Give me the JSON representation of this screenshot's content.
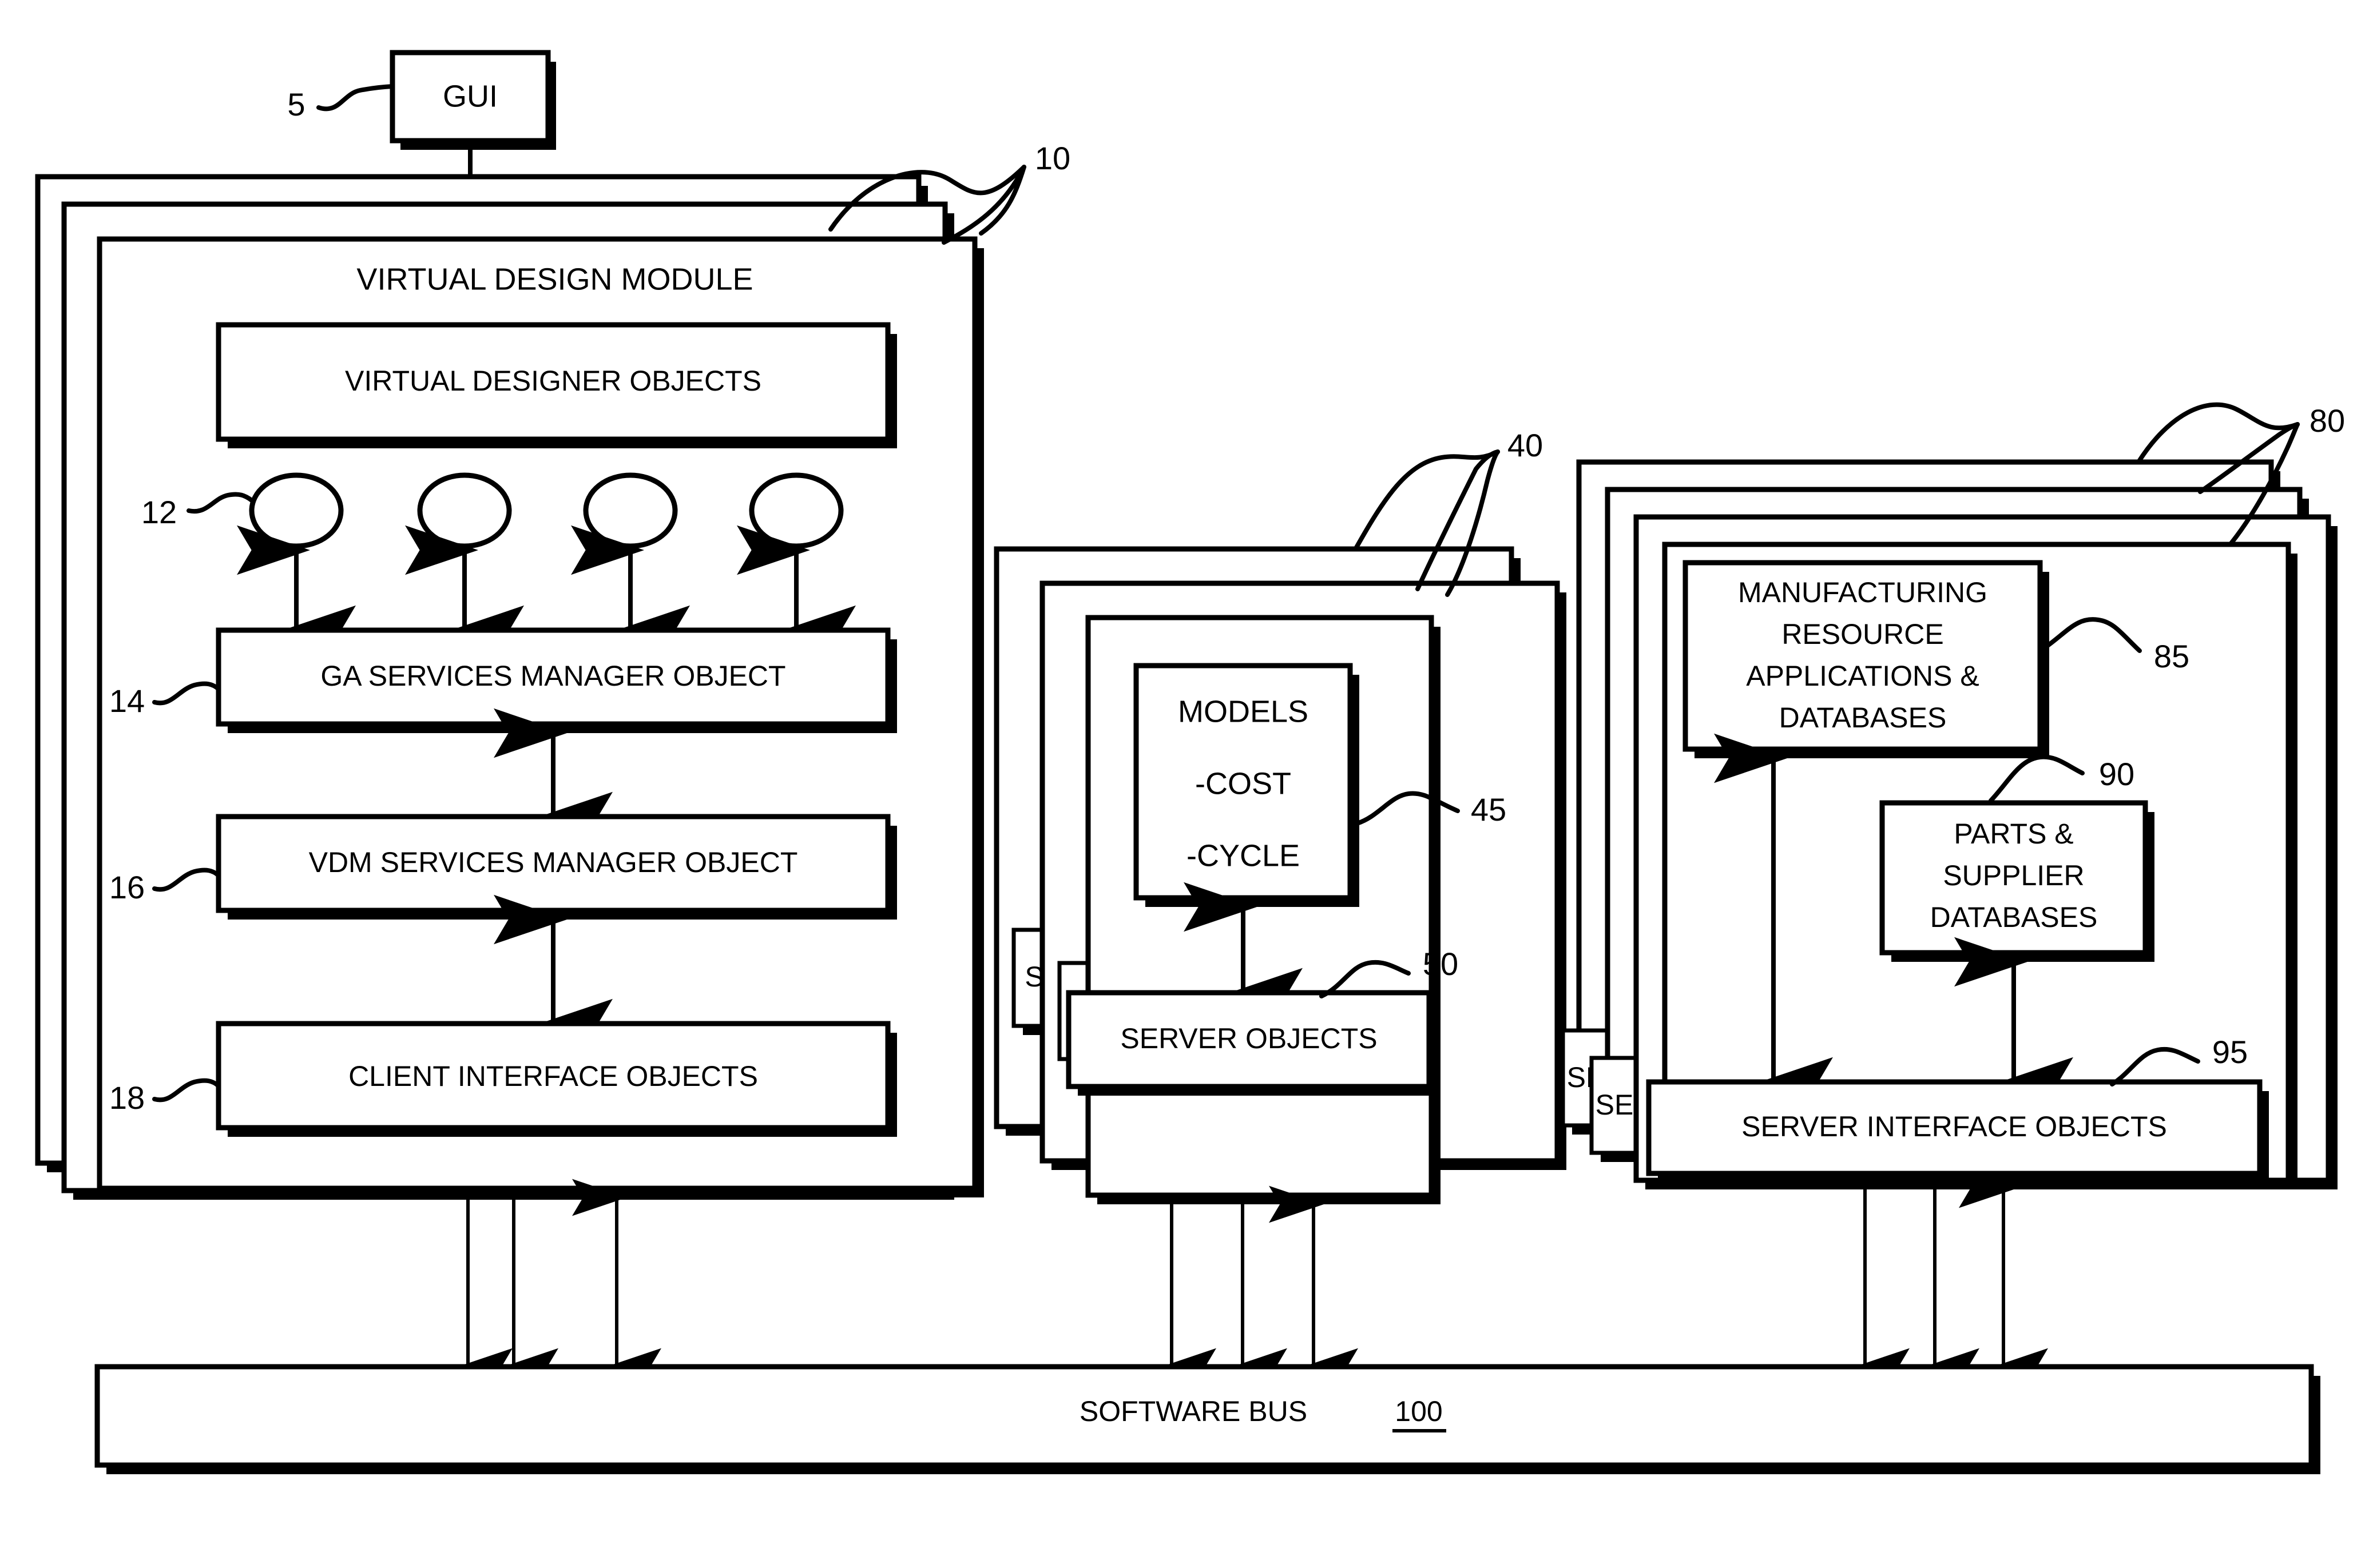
{
  "figure": {
    "title": "Virtual Design Module system architecture block diagram",
    "background_color": "#ffffff",
    "line_color": "#000000"
  },
  "blocks": {
    "gui": "GUI",
    "virtual_design_module": "VIRTUAL DESIGN MODULE",
    "virtual_designer_objects": "VIRTUAL DESIGNER OBJECTS",
    "ga_services_manager_object": "GA SERVICES MANAGER OBJECT",
    "vdm_services_manager_object": "VDM SERVICES MANAGER OBJECT",
    "client_interface_objects": "CLIENT INTERFACE OBJECTS",
    "models_title": "MODELS",
    "models_item_cost": "-COST",
    "models_item_cycle": "-CYCLE",
    "server_objects": "SERVER OBJECTS",
    "server_objects_abbrev": "S",
    "manufacturing_line1": "MANUFACTURING",
    "manufacturing_line2": "RESOURCE",
    "manufacturing_line3": "APPLICATIONS &",
    "manufacturing_line4": "DATABASES",
    "parts_line1": "PARTS &",
    "parts_line2": "SUPPLIER",
    "parts_line3": "DATABASES",
    "server_interface_objects": "SERVER INTERFACE OBJECTS",
    "server_interface_objects_abbrev": "SE",
    "software_bus": "SOFTWARE BUS"
  },
  "reference_numerals": {
    "gui": "5",
    "vdm_stack": "10",
    "designer_agents": "12",
    "ga_services": "14",
    "vdm_services": "16",
    "client_interface": "18",
    "model_server_stack": "40",
    "models": "45",
    "server_objects": "50",
    "resource_server_stack": "80",
    "manufacturing_apps": "85",
    "parts_supplier": "90",
    "server_interface": "95",
    "software_bus": "100"
  }
}
